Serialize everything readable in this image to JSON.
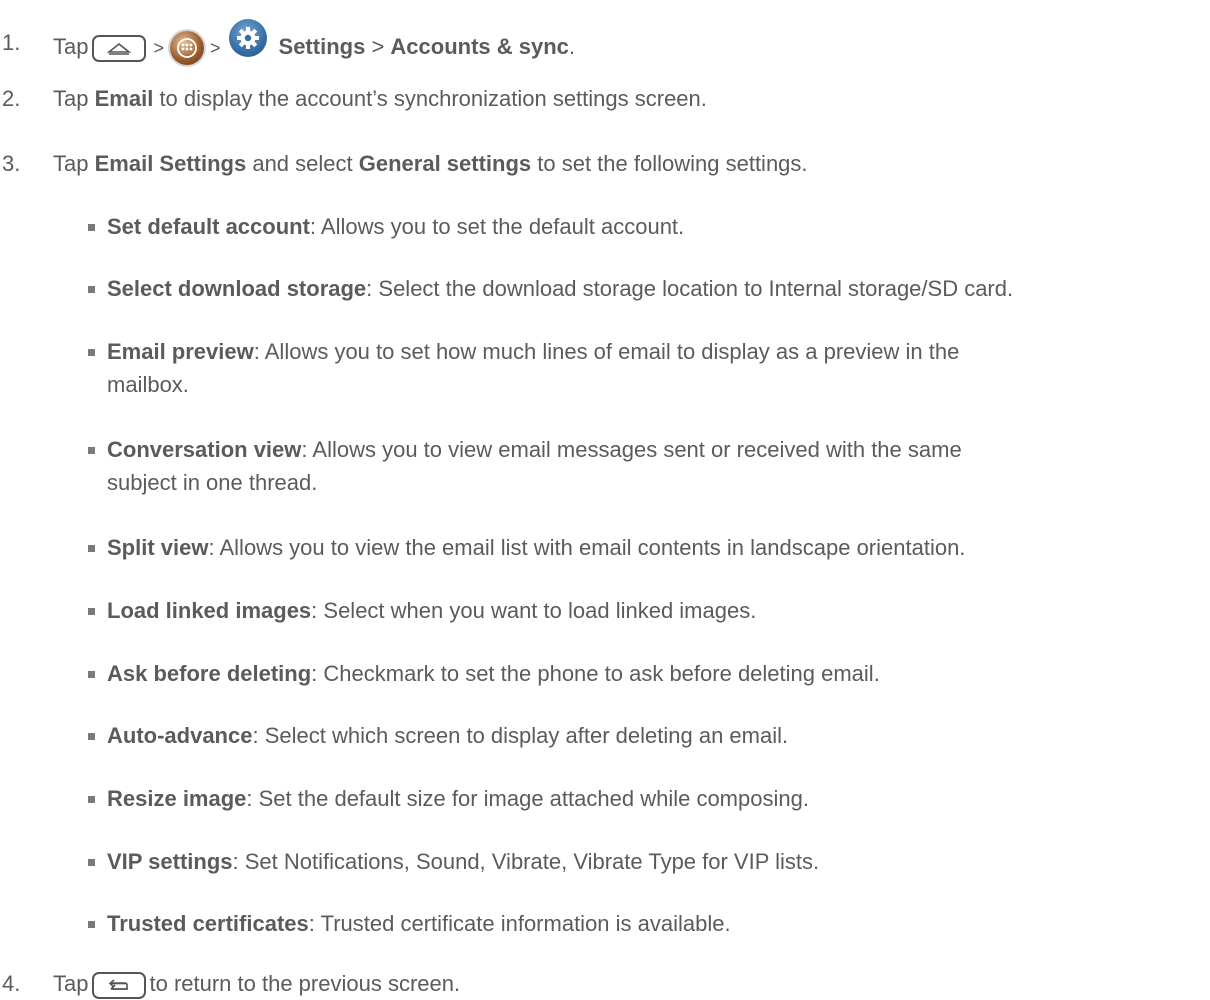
{
  "steps": {
    "s1": {
      "num": "1.",
      "tap": "Tap",
      "gt1": ">",
      "gt2": ">",
      "settings": "Settings",
      "gt3": ">",
      "accounts": "Accounts & sync",
      "end": "."
    },
    "s2": {
      "num": "2.",
      "tap": "Tap",
      "email": "Email",
      "rest": "to display the account’s synchronization settings screen."
    },
    "s3": {
      "num": "3.",
      "tap": "Tap",
      "email_settings": "Email Settings",
      "and_select": "and select",
      "general": "General settings",
      "rest": "to set the following settings."
    },
    "s4": {
      "num": "4.",
      "tap": "Tap",
      "rest": "to return to the previous screen."
    }
  },
  "settings_list": [
    {
      "term": "Set default account",
      "desc": ": Allows you to set the default account."
    },
    {
      "term": "Select download storage",
      "desc": ": Select the download storage location to Internal storage/SD card."
    },
    {
      "term": "Email preview",
      "desc": ": Allows you to set how much lines of email to display as a preview in the",
      "desc2": "mailbox."
    },
    {
      "term": "Conversation view",
      "desc": ": Allows you to view email messages sent or received with the same",
      "desc2": "subject in one thread."
    },
    {
      "term": "Split view",
      "desc": ": Allows you to view the email list with email contents in landscape orientation."
    },
    {
      "term": "Load linked images",
      "desc": ": Select when you want to load linked images."
    },
    {
      "term": "Ask before deleting",
      "desc": ": Checkmark to set the phone to ask before deleting email."
    },
    {
      "term": "Auto-advance",
      "desc": ": Select which screen to display after deleting an email."
    },
    {
      "term": "Resize image",
      "desc": ": Set the default size for image attached while composing."
    },
    {
      "term": "VIP settings",
      "desc": ": Set Notifications, Sound, Vibrate, Vibrate Type for VIP lists."
    },
    {
      "term": "Trusted certificates",
      "desc": ": Trusted certificate information is available."
    }
  ],
  "icons": {
    "home": "home-key-icon",
    "apps": "apps-icon",
    "settings": "settings-gear-icon",
    "back": "back-key-icon"
  }
}
